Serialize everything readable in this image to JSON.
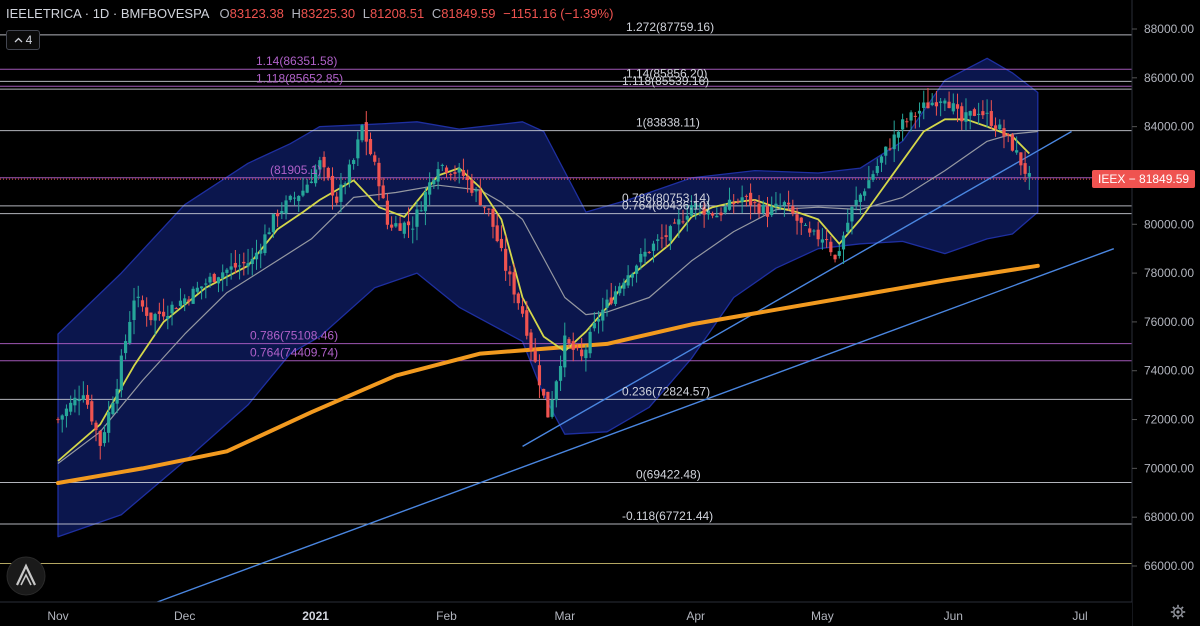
{
  "header": {
    "symbol": "IEELETRICA · 1D · BMFBOVESPA",
    "open_label": "O",
    "open_value": "83123.38",
    "high_label": "H",
    "high_value": "83225.30",
    "low_label": "L",
    "low_value": "81208.51",
    "close_label": "C",
    "close_value": "81849.59",
    "change": "−1151.16 (−1.39%)"
  },
  "indicators_toggle": {
    "icon": "chevron-up-icon",
    "count": "4"
  },
  "price_tag": {
    "symbol": "IEEX",
    "price": "81849.59",
    "text": "IEEX − 81849.59"
  },
  "colors": {
    "background": "#000000",
    "up": "#26a69a",
    "down": "#ef5350",
    "bollinger_fill": "#0d1a5a",
    "bollinger_edge": "#1e2fa0",
    "ema_fast": "#d4d74a",
    "sma_mid": "#9598a1",
    "ma_long": "#f29a1f",
    "trendline": "#4a86e0",
    "fib_white": "#d1d4dc",
    "fib_purple": "#b061c9"
  },
  "chart_data": {
    "type": "candlestick",
    "y_axis": {
      "ticks": [
        "88000.00",
        "86000.00",
        "84000.00",
        "82000.00",
        "80000.00",
        "78000.00",
        "76000.00",
        "74000.00",
        "72000.00",
        "70000.00",
        "68000.00",
        "66000.00"
      ],
      "range": [
        64500,
        88700
      ]
    },
    "x_axis": {
      "ticks": [
        "Nov",
        "Dec",
        "2021",
        "Feb",
        "Mar",
        "Apr",
        "May",
        "Jun",
        "Jul"
      ],
      "bold": [
        "2021"
      ],
      "range_days": [
        0,
        250
      ],
      "tick_days": [
        0,
        30,
        61,
        92,
        120,
        151,
        181,
        212,
        242
      ]
    },
    "fib_levels_white": [
      {
        "label": "1.272(87759.16)",
        "value": 87759.16
      },
      {
        "label": "1.14(85856.20)",
        "value": 85856.2
      },
      {
        "label": "1.118(85539.16)",
        "value": 85539.16
      },
      {
        "label": "1(83838.11)",
        "value": 83838.11
      },
      {
        "label": "0.786(80753.14)",
        "value": 80753.14
      },
      {
        "label": "0.764(80436.10)",
        "value": 80436.1
      },
      {
        "label": "0.236(72824.57)",
        "value": 72824.57
      },
      {
        "label": "0(69422.48)",
        "value": 69422.48
      },
      {
        "label": "-0.118(67721.44)",
        "value": 67721.44
      }
    ],
    "fib_levels_purple": [
      {
        "label": "1.14(86351.58)",
        "value": 86351.58
      },
      {
        "label": "1.118(85652.85)",
        "value": 85652.85
      },
      {
        "label": "(81905.1)",
        "value": 81905.1
      },
      {
        "label": "0.786(75108.46)",
        "value": 75108.46
      },
      {
        "label": "0.764(74409.74)",
        "value": 74409.74
      }
    ],
    "horizontal_lines": [
      {
        "value": 81849.59,
        "kind": "last-price"
      },
      {
        "value": 66100,
        "kind": "fib-extra"
      }
    ],
    "trendlines": [
      {
        "points": [
          [
            110,
            70900
          ],
          [
            240,
            83800
          ]
        ]
      },
      {
        "points": [
          [
            20,
            64300
          ],
          [
            250,
            79000
          ]
        ]
      }
    ],
    "bands_upper": [
      [
        0,
        75500
      ],
      [
        15,
        78000
      ],
      [
        30,
        80800
      ],
      [
        45,
        82500
      ],
      [
        55,
        83300
      ],
      [
        62,
        84000
      ],
      [
        75,
        84100
      ],
      [
        85,
        84200
      ],
      [
        95,
        83900
      ],
      [
        110,
        84200
      ],
      [
        115,
        83800
      ],
      [
        125,
        80500
      ],
      [
        135,
        81000
      ],
      [
        150,
        81900
      ],
      [
        165,
        82200
      ],
      [
        180,
        82100
      ],
      [
        190,
        82300
      ],
      [
        200,
        83400
      ],
      [
        210,
        85900
      ],
      [
        220,
        86800
      ],
      [
        226,
        86200
      ],
      [
        232,
        85400
      ]
    ],
    "bands_lower": [
      [
        0,
        67200
      ],
      [
        15,
        68100
      ],
      [
        30,
        70300
      ],
      [
        45,
        72600
      ],
      [
        55,
        74700
      ],
      [
        62,
        75400
      ],
      [
        75,
        77400
      ],
      [
        85,
        78000
      ],
      [
        95,
        76600
      ],
      [
        110,
        75200
      ],
      [
        115,
        73000
      ],
      [
        120,
        71400
      ],
      [
        130,
        71500
      ],
      [
        140,
        72500
      ],
      [
        150,
        74500
      ],
      [
        160,
        77000
      ],
      [
        170,
        78200
      ],
      [
        180,
        79000
      ],
      [
        190,
        79200
      ],
      [
        200,
        79300
      ],
      [
        210,
        78800
      ],
      [
        220,
        79400
      ],
      [
        226,
        79600
      ],
      [
        232,
        80500
      ]
    ],
    "ema_fast": [
      [
        0,
        70300
      ],
      [
        10,
        71800
      ],
      [
        18,
        74200
      ],
      [
        25,
        76000
      ],
      [
        35,
        77400
      ],
      [
        45,
        78300
      ],
      [
        52,
        79800
      ],
      [
        58,
        80500
      ],
      [
        62,
        81000
      ],
      [
        70,
        81800
      ],
      [
        76,
        80700
      ],
      [
        82,
        80300
      ],
      [
        90,
        82000
      ],
      [
        95,
        82300
      ],
      [
        100,
        81500
      ],
      [
        105,
        80200
      ],
      [
        110,
        77000
      ],
      [
        115,
        75400
      ],
      [
        120,
        74800
      ],
      [
        125,
        75600
      ],
      [
        130,
        76600
      ],
      [
        135,
        77800
      ],
      [
        140,
        78500
      ],
      [
        145,
        79200
      ],
      [
        150,
        80300
      ],
      [
        155,
        80700
      ],
      [
        160,
        80900
      ],
      [
        165,
        81000
      ],
      [
        170,
        80700
      ],
      [
        175,
        80500
      ],
      [
        180,
        80200
      ],
      [
        185,
        79200
      ],
      [
        190,
        80200
      ],
      [
        195,
        81400
      ],
      [
        200,
        82600
      ],
      [
        205,
        83800
      ],
      [
        210,
        84300
      ],
      [
        215,
        84300
      ],
      [
        220,
        84000
      ],
      [
        226,
        83600
      ],
      [
        230,
        82900
      ]
    ],
    "sma_mid": [
      [
        0,
        70200
      ],
      [
        10,
        71500
      ],
      [
        20,
        73600
      ],
      [
        30,
        75500
      ],
      [
        40,
        77200
      ],
      [
        50,
        78300
      ],
      [
        60,
        79400
      ],
      [
        70,
        81100
      ],
      [
        80,
        81300
      ],
      [
        90,
        81600
      ],
      [
        100,
        81400
      ],
      [
        105,
        80900
      ],
      [
        110,
        80200
      ],
      [
        115,
        78600
      ],
      [
        120,
        77000
      ],
      [
        125,
        76300
      ],
      [
        130,
        76400
      ],
      [
        140,
        77000
      ],
      [
        150,
        78500
      ],
      [
        160,
        79700
      ],
      [
        170,
        80600
      ],
      [
        180,
        80700
      ],
      [
        190,
        80600
      ],
      [
        200,
        81100
      ],
      [
        210,
        82200
      ],
      [
        220,
        83400
      ],
      [
        226,
        83700
      ],
      [
        232,
        83800
      ]
    ],
    "ma_long": [
      [
        0,
        69400
      ],
      [
        20,
        70000
      ],
      [
        40,
        70700
      ],
      [
        60,
        72300
      ],
      [
        80,
        73800
      ],
      [
        100,
        74700
      ],
      [
        115,
        74900
      ],
      [
        130,
        75100
      ],
      [
        150,
        75900
      ],
      [
        170,
        76500
      ],
      [
        190,
        77100
      ],
      [
        210,
        77700
      ],
      [
        232,
        78300
      ]
    ],
    "candles_seed": 7,
    "candles_path": [
      [
        0,
        72000
      ],
      [
        6,
        73200
      ],
      [
        10,
        71000
      ],
      [
        14,
        73500
      ],
      [
        18,
        77000
      ],
      [
        22,
        76200
      ],
      [
        26,
        76500
      ],
      [
        32,
        77200
      ],
      [
        38,
        78000
      ],
      [
        46,
        78500
      ],
      [
        52,
        80500
      ],
      [
        58,
        81400
      ],
      [
        62,
        82500
      ],
      [
        66,
        81000
      ],
      [
        70,
        82600
      ],
      [
        72,
        84000
      ],
      [
        76,
        81800
      ],
      [
        78,
        80000
      ],
      [
        84,
        80000
      ],
      [
        90,
        82500
      ],
      [
        96,
        82000
      ],
      [
        102,
        80500
      ],
      [
        106,
        78200
      ],
      [
        110,
        76400
      ],
      [
        112,
        75000
      ],
      [
        116,
        72200
      ],
      [
        120,
        75200
      ],
      [
        124,
        74500
      ],
      [
        128,
        76200
      ],
      [
        134,
        77800
      ],
      [
        140,
        79000
      ],
      [
        146,
        79800
      ],
      [
        150,
        80800
      ],
      [
        156,
        80400
      ],
      [
        162,
        81100
      ],
      [
        168,
        80500
      ],
      [
        172,
        80800
      ],
      [
        178,
        79500
      ],
      [
        182,
        79500
      ],
      [
        184,
        78500
      ],
      [
        188,
        80600
      ],
      [
        196,
        83000
      ],
      [
        200,
        84100
      ],
      [
        205,
        84800
      ],
      [
        210,
        85300
      ],
      [
        214,
        84200
      ],
      [
        218,
        84700
      ],
      [
        222,
        84100
      ],
      [
        226,
        83200
      ],
      [
        230,
        81850
      ]
    ]
  }
}
